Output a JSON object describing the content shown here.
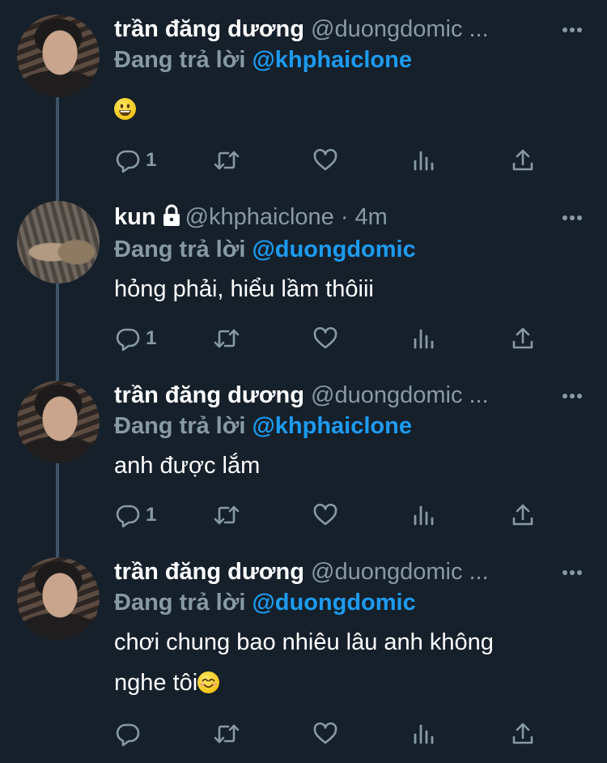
{
  "tweets": [
    {
      "name": "trần đăng dương",
      "handle": "@duongdomic ...",
      "replying_prefix": "Đang trả lời ",
      "replying_to": "@khphaiclone",
      "text": "",
      "emoji": "grinning-face",
      "reply_count": "1",
      "avatar": "person-photo"
    },
    {
      "name": "kun",
      "locked": true,
      "handle": "@khphaiclone · 4m",
      "replying_prefix": "Đang trả lời ",
      "replying_to": "@duongdomic",
      "text": "hỏng phải, hiểu lầm thôiii",
      "reply_count": "1",
      "avatar": "cat-photo"
    },
    {
      "name": "trần đăng dương",
      "handle": "@duongdomic ...",
      "replying_prefix": "Đang trả lời ",
      "replying_to": "@khphaiclone",
      "text": "anh được lắm",
      "reply_count": "1",
      "avatar": "person-photo"
    },
    {
      "name": "trần đăng dương",
      "handle": "@duongdomic ...",
      "replying_prefix": "Đang trả lời ",
      "replying_to": "@duongdomic",
      "text_line1": "chơi chung bao nhiêu lâu anh không",
      "text_line2": "nghe tôi",
      "emoji": "smiling-face-with-smiling-eyes",
      "reply_count": "",
      "avatar": "person-photo"
    }
  ],
  "colors": {
    "background": "#15202b",
    "text": "#ffffff",
    "muted": "#8899a6",
    "mention": "#1d9bf0",
    "thread_line": "#3d5466"
  },
  "icons": [
    "reply-icon",
    "retweet-icon",
    "like-icon",
    "analytics-icon",
    "share-icon",
    "more-icon",
    "lock-icon"
  ]
}
